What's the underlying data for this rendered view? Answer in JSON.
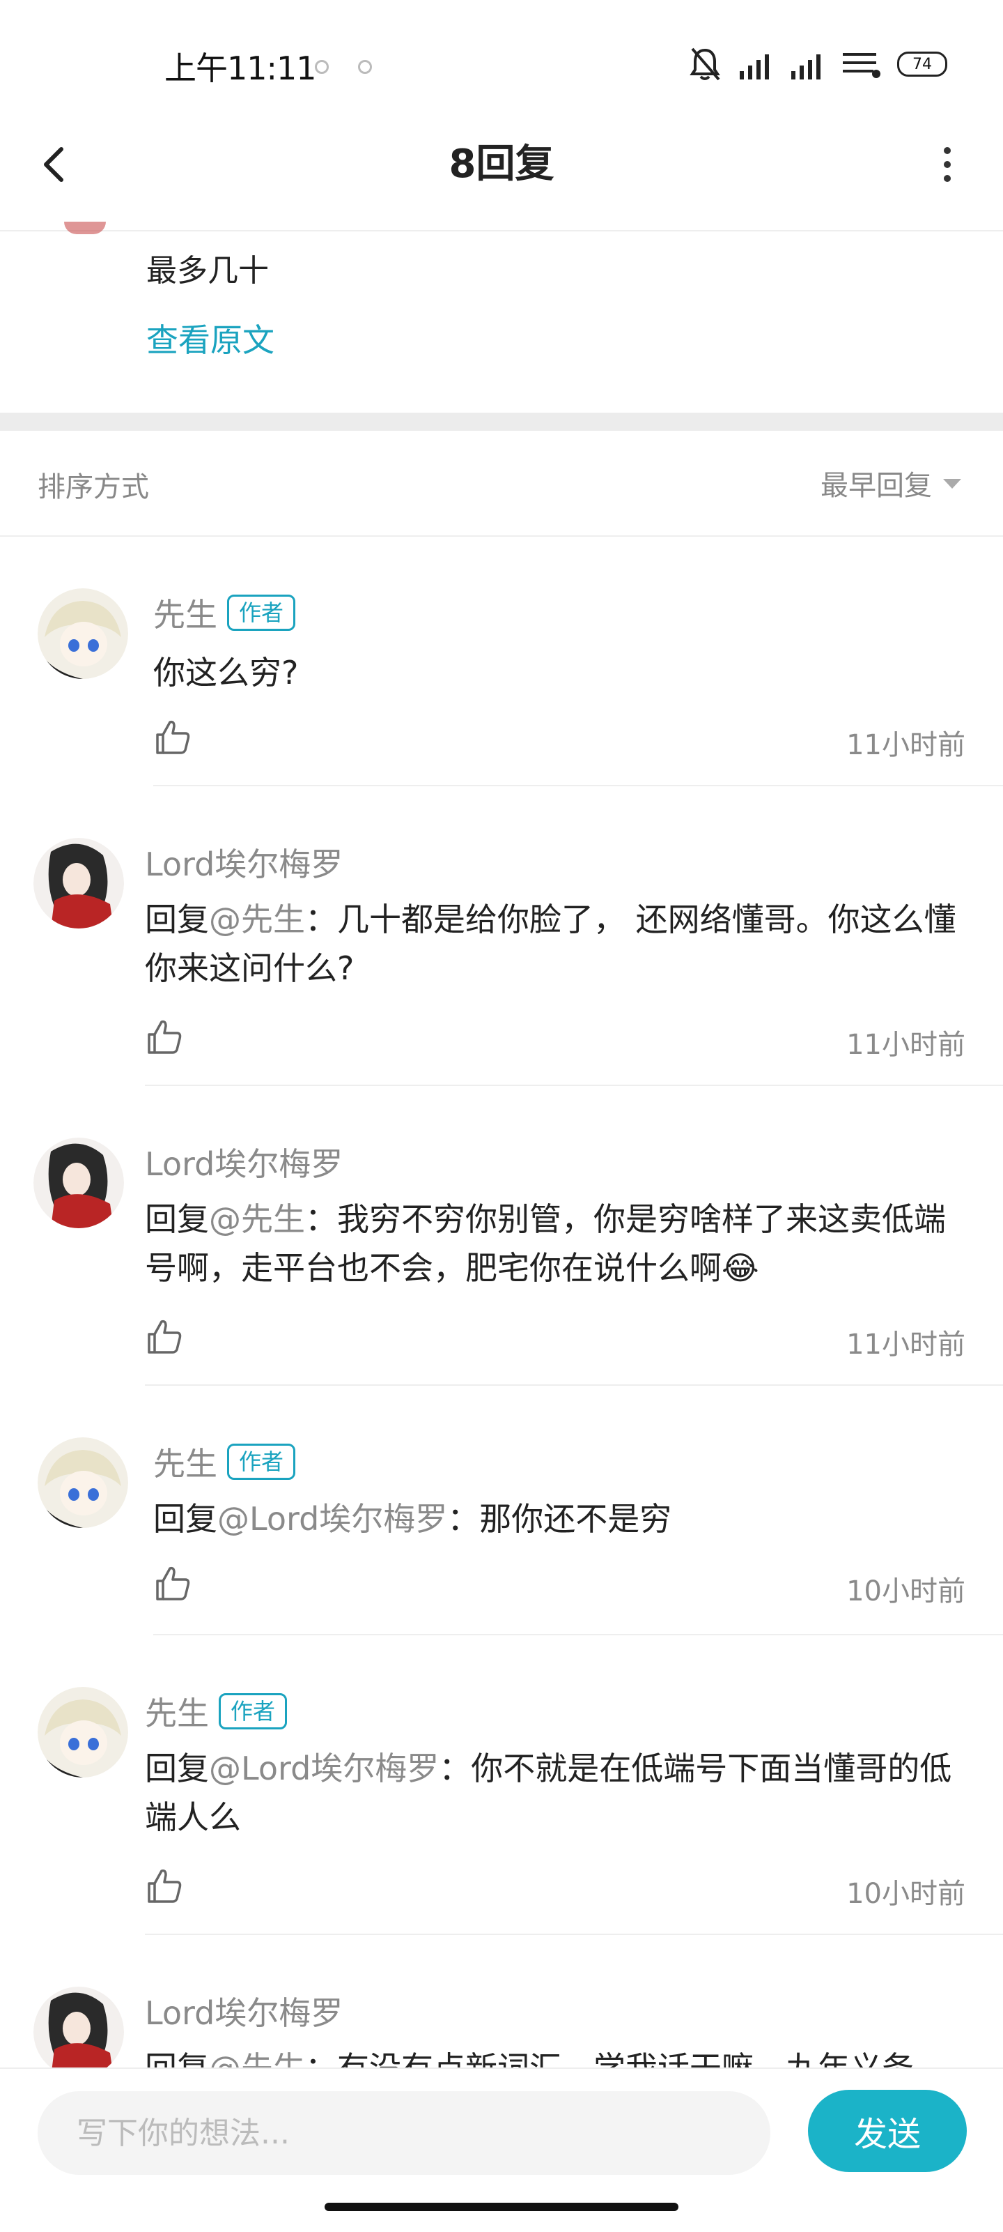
{
  "status_bar": {
    "time": "上午11:11",
    "battery": "74"
  },
  "header": {
    "title": "8回复"
  },
  "original": {
    "text": "最多几十",
    "view_original": "查看原文"
  },
  "sort": {
    "label": "排序方式",
    "selected": "最早回复"
  },
  "author_badge": "作者",
  "comments": [
    {
      "user": "先生",
      "is_author": true,
      "reply_prefix": "",
      "mention": "",
      "text": "你这么穷?",
      "time": "11小时前"
    },
    {
      "user": "Lord埃尔梅罗",
      "is_author": false,
      "reply_prefix": "回复",
      "mention": "@先生",
      "text": "：几十都是给你脸了， 还网络懂哥。你这么懂你来这问什么?",
      "time": "11小时前"
    },
    {
      "user": "Lord埃尔梅罗",
      "is_author": false,
      "reply_prefix": "回复",
      "mention": "@先生",
      "text": "：我穷不穷你别管，你是穷啥样了来这卖低端号啊，走平台也不会，肥宅你在说什么啊😂",
      "time": "11小时前"
    },
    {
      "user": "先生",
      "is_author": true,
      "reply_prefix": "回复",
      "mention": "@Lord埃尔梅罗",
      "text": "：那你还不是穷",
      "time": "10小时前"
    },
    {
      "user": "先生",
      "is_author": true,
      "reply_prefix": "回复",
      "mention": "@Lord埃尔梅罗",
      "text": "：你不就是在低端号下面当懂哥的低端人么",
      "time": "10小时前"
    },
    {
      "user": "Lord埃尔梅罗",
      "is_author": false,
      "reply_prefix": "回复",
      "mention": "@先生",
      "text": "：有没有点新词汇，学我话干嘛，九年义务",
      "time": ""
    }
  ],
  "input": {
    "placeholder": "写下你的想法..."
  },
  "send_label": "发送",
  "colors": {
    "accent": "#1aa3bf",
    "send_button": "#1bb3c8",
    "muted_text": "#8a8a8a"
  }
}
